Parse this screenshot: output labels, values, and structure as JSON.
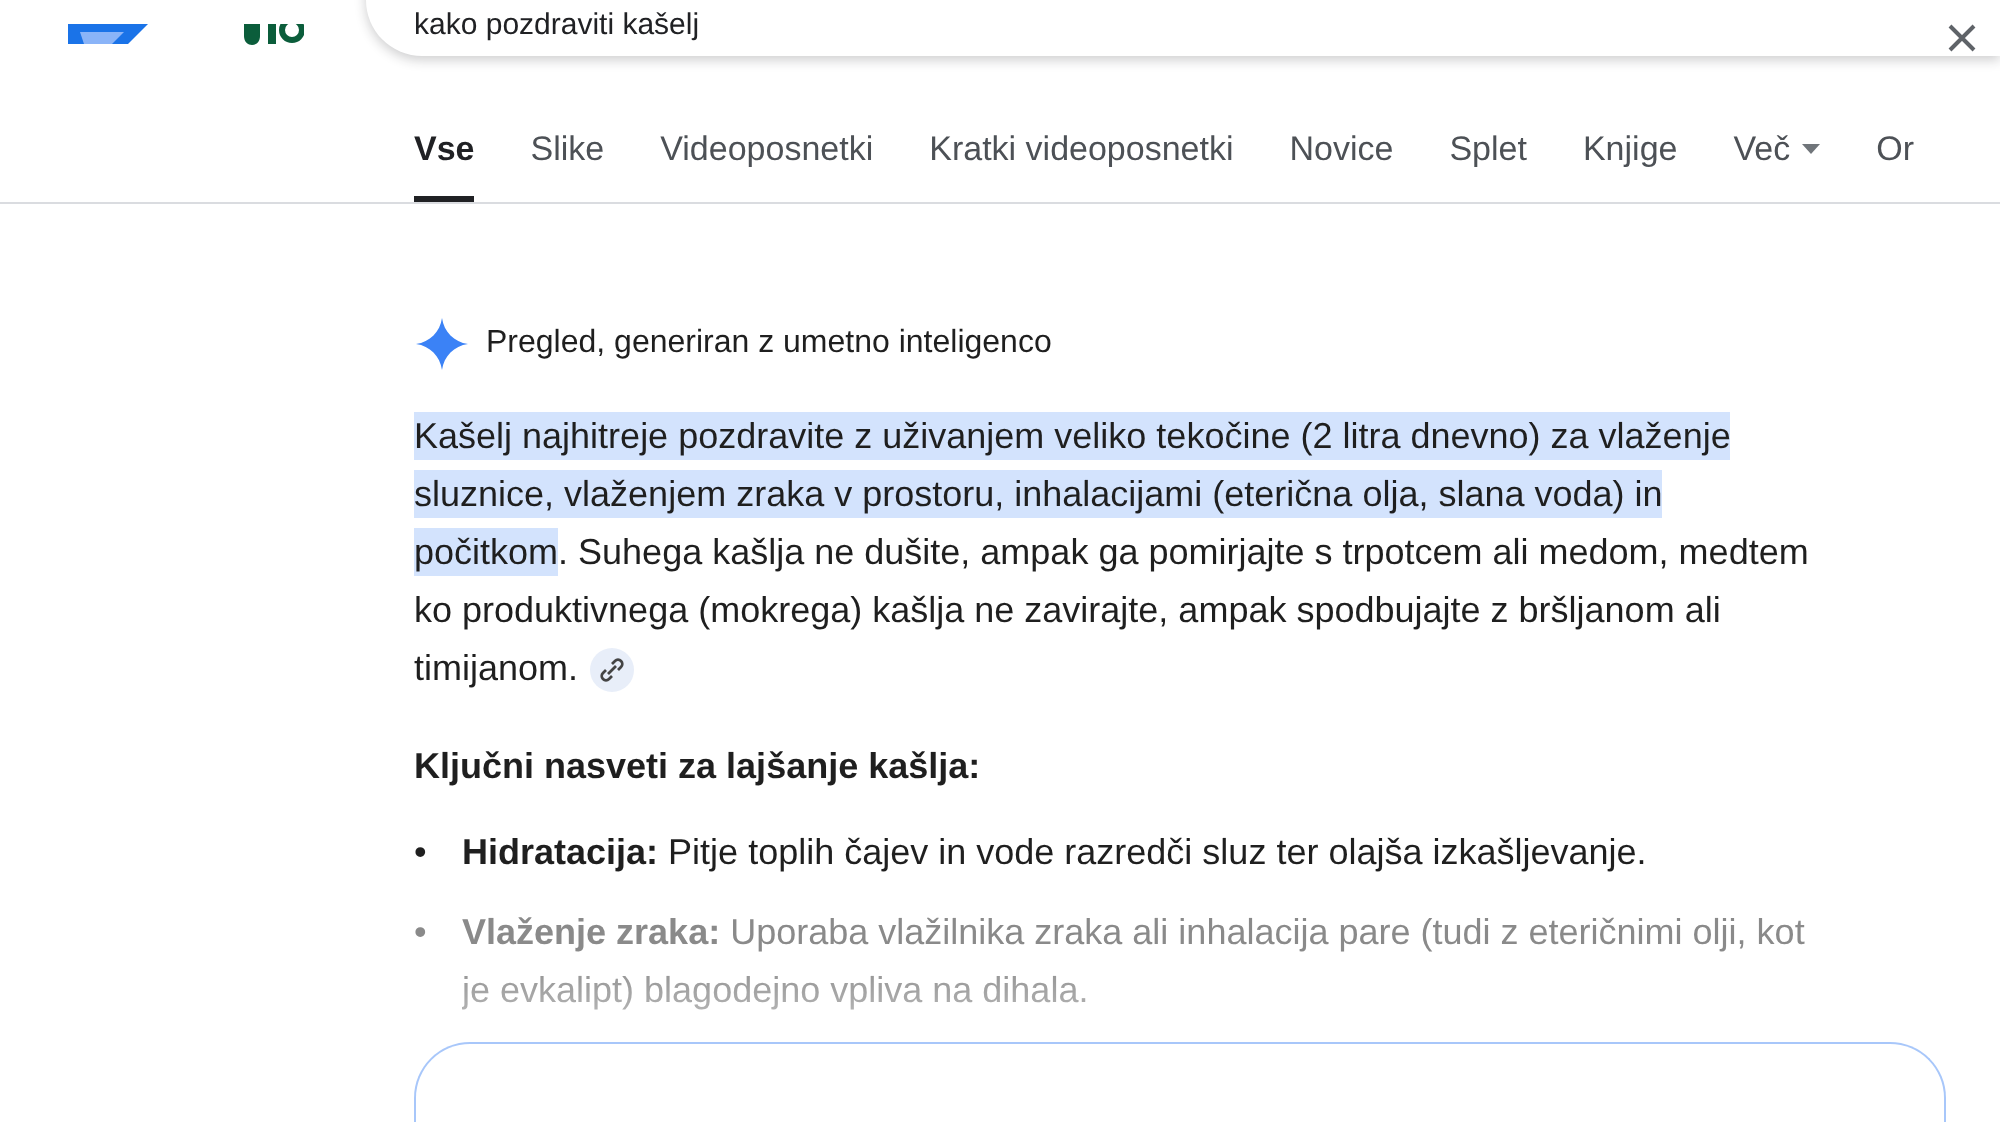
{
  "search": {
    "value": "kako pozdraviti kašelj"
  },
  "tabs": [
    {
      "label": "Vse",
      "selected": true
    },
    {
      "label": "Slike",
      "selected": false
    },
    {
      "label": "Videoposnetki",
      "selected": false
    },
    {
      "label": "Kratki videoposnetki",
      "selected": false
    },
    {
      "label": "Novice",
      "selected": false
    },
    {
      "label": "Splet",
      "selected": false
    },
    {
      "label": "Knjige",
      "selected": false
    },
    {
      "label": "Več",
      "selected": false,
      "kind": "menu"
    },
    {
      "label": "Or",
      "selected": false
    }
  ],
  "overview": {
    "title": "Pregled, generiran z umetno inteligenco",
    "summary": {
      "highlighted": "Kašelj najhitreje pozdravite z uživanjem veliko tekočine (2 litra dnevno) za vlaženje sluznice, vlaženjem zraka v prostoru, inhalacijami (eterična olja, slana voda) in počitkom",
      "rest": ". Suhega kašlja ne dušite, ampak ga pomirjajte s trpotcem ali medom, medtem ko produktivnega (mokrega) kašlja ne zavirajte, ampak spodbujajte z bršljanom ali timijanom."
    },
    "heading": "Ključni nasveti za lajšanje kašlja:",
    "tips": [
      {
        "marker": "•",
        "term": "Hidratacija:",
        "text": "Pitje toplih čajev in vode razredči sluz ter olajša izkašljevanje.",
        "faded": false
      },
      {
        "marker": "•",
        "term": "Vlaženje zraka:",
        "text": "Uporaba vlažilnika zraka ali inhalacija pare (tudi z eteričnimi olji, kot je evkalipt) blagodejno vpliva na dihala.",
        "faded": true
      }
    ]
  }
}
